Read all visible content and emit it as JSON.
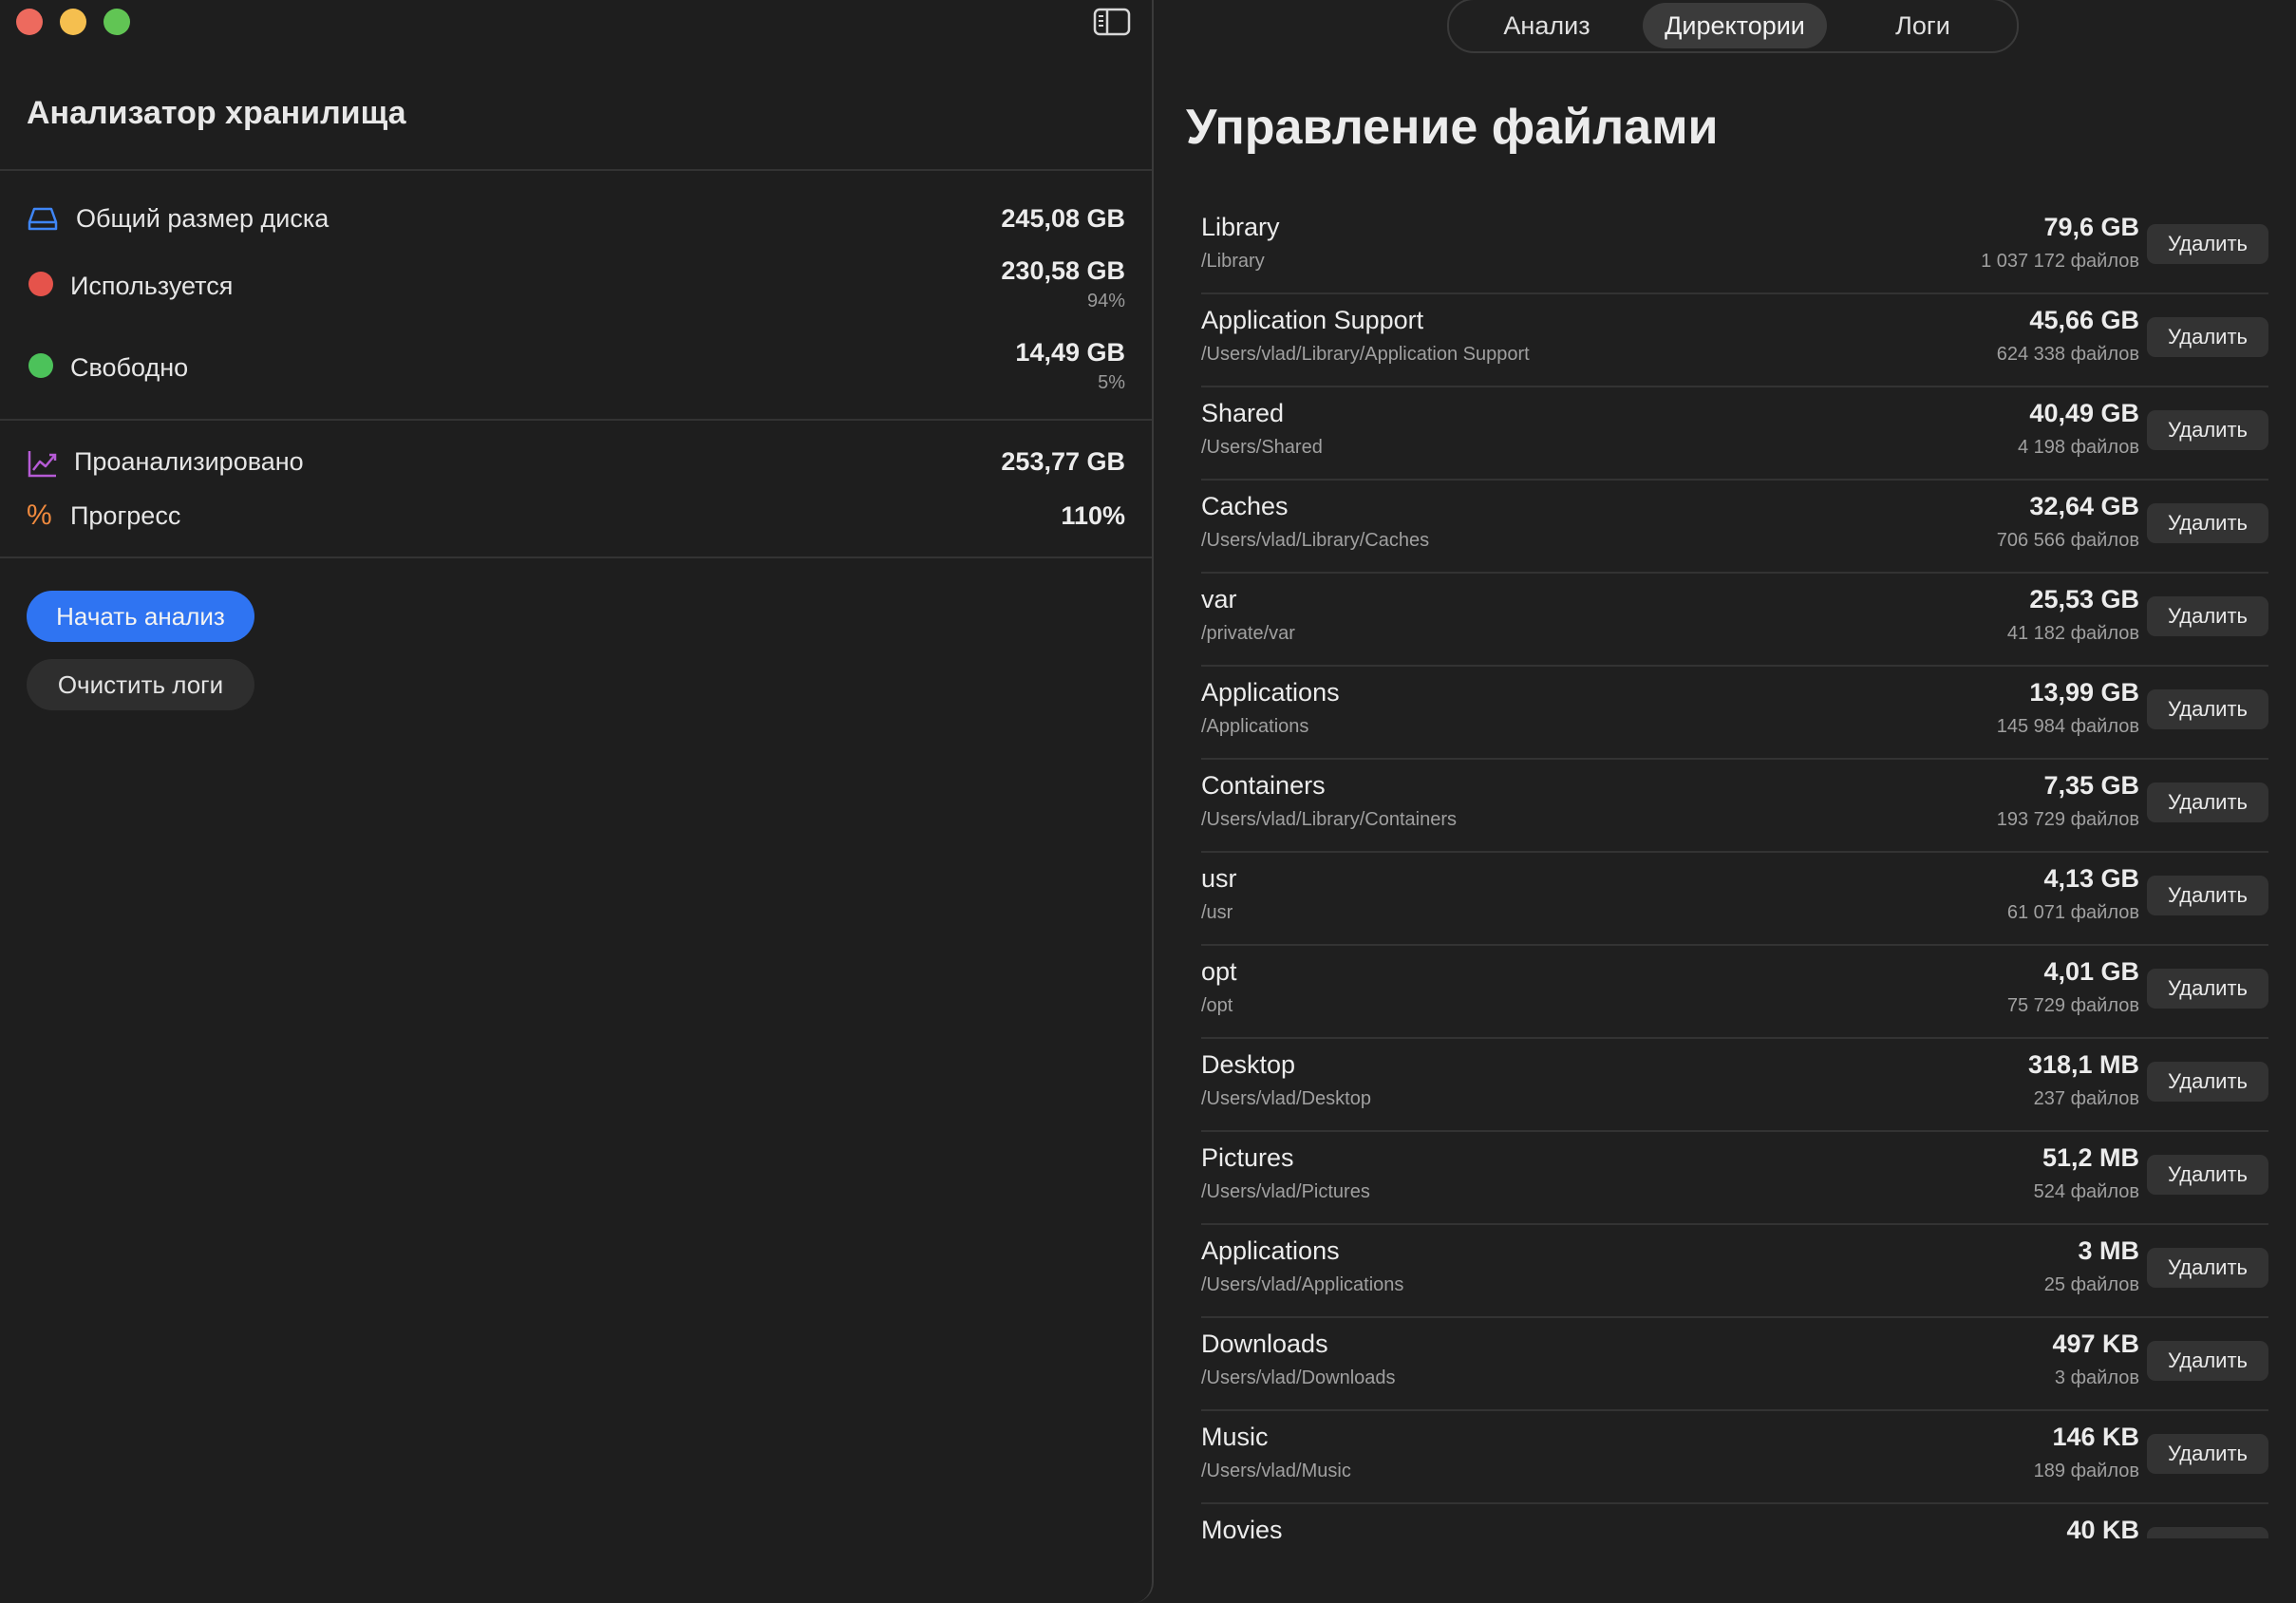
{
  "sidebar": {
    "title": "Анализатор хранилища",
    "stats": {
      "disk_label": "Общий размер диска",
      "disk_value": "245,08 GB",
      "used_label": "Используется",
      "used_value": "230,58 GB",
      "used_percent": "94%",
      "free_label": "Свободно",
      "free_value": "14,49 GB",
      "free_percent": "5%",
      "analyzed_label": "Проанализировано",
      "analyzed_value": "253,77 GB",
      "progress_label": "Прогресс",
      "progress_value": "110%"
    },
    "buttons": {
      "start": "Начать анализ",
      "clear": "Очистить логи"
    }
  },
  "tabs": [
    "Анализ",
    "Директории",
    "Логи"
  ],
  "active_tab": "Директории",
  "main": {
    "title": "Управление файлами",
    "delete_label": "Удалить",
    "rows": [
      {
        "name": "Library",
        "path": "/Library",
        "size": "79,6 GB",
        "count": "1 037 172 файлов"
      },
      {
        "name": "Application Support",
        "path": "/Users/vlad/Library/Application Support",
        "size": "45,66 GB",
        "count": "624 338 файлов"
      },
      {
        "name": "Shared",
        "path": "/Users/Shared",
        "size": "40,49 GB",
        "count": "4 198 файлов"
      },
      {
        "name": "Caches",
        "path": "/Users/vlad/Library/Caches",
        "size": "32,64 GB",
        "count": "706 566 файлов"
      },
      {
        "name": "var",
        "path": "/private/var",
        "size": "25,53 GB",
        "count": "41 182 файлов"
      },
      {
        "name": "Applications",
        "path": "/Applications",
        "size": "13,99 GB",
        "count": "145 984 файлов"
      },
      {
        "name": "Containers",
        "path": "/Users/vlad/Library/Containers",
        "size": "7,35 GB",
        "count": "193 729 файлов"
      },
      {
        "name": "usr",
        "path": "/usr",
        "size": "4,13 GB",
        "count": "61 071 файлов"
      },
      {
        "name": "opt",
        "path": "/opt",
        "size": "4,01 GB",
        "count": "75 729 файлов"
      },
      {
        "name": "Desktop",
        "path": "/Users/vlad/Desktop",
        "size": "318,1 MB",
        "count": "237 файлов"
      },
      {
        "name": "Pictures",
        "path": "/Users/vlad/Pictures",
        "size": "51,2 MB",
        "count": "524 файлов"
      },
      {
        "name": "Applications",
        "path": "/Users/vlad/Applications",
        "size": "3 MB",
        "count": "25 файлов"
      },
      {
        "name": "Downloads",
        "path": "/Users/vlad/Downloads",
        "size": "497 KB",
        "count": "3 файлов"
      },
      {
        "name": "Music",
        "path": "/Users/vlad/Music",
        "size": "146 KB",
        "count": "189 файлов"
      },
      {
        "name": "Movies",
        "path": "",
        "size": "40 KB",
        "count": ""
      }
    ]
  },
  "colors": {
    "used_dot": "#e5534b",
    "free_dot": "#4cc25a",
    "accent": "#2f74f2",
    "disk_icon": "#3f86f7",
    "chart_icon": "#b65bd6",
    "percent_icon": "#f08a3e"
  },
  "icons": {
    "disk": "internaldrive-icon",
    "analyzed": "chart-line-icon",
    "progress": "percent-icon",
    "sidebar_toggle": "sidebar-toggle-icon"
  }
}
